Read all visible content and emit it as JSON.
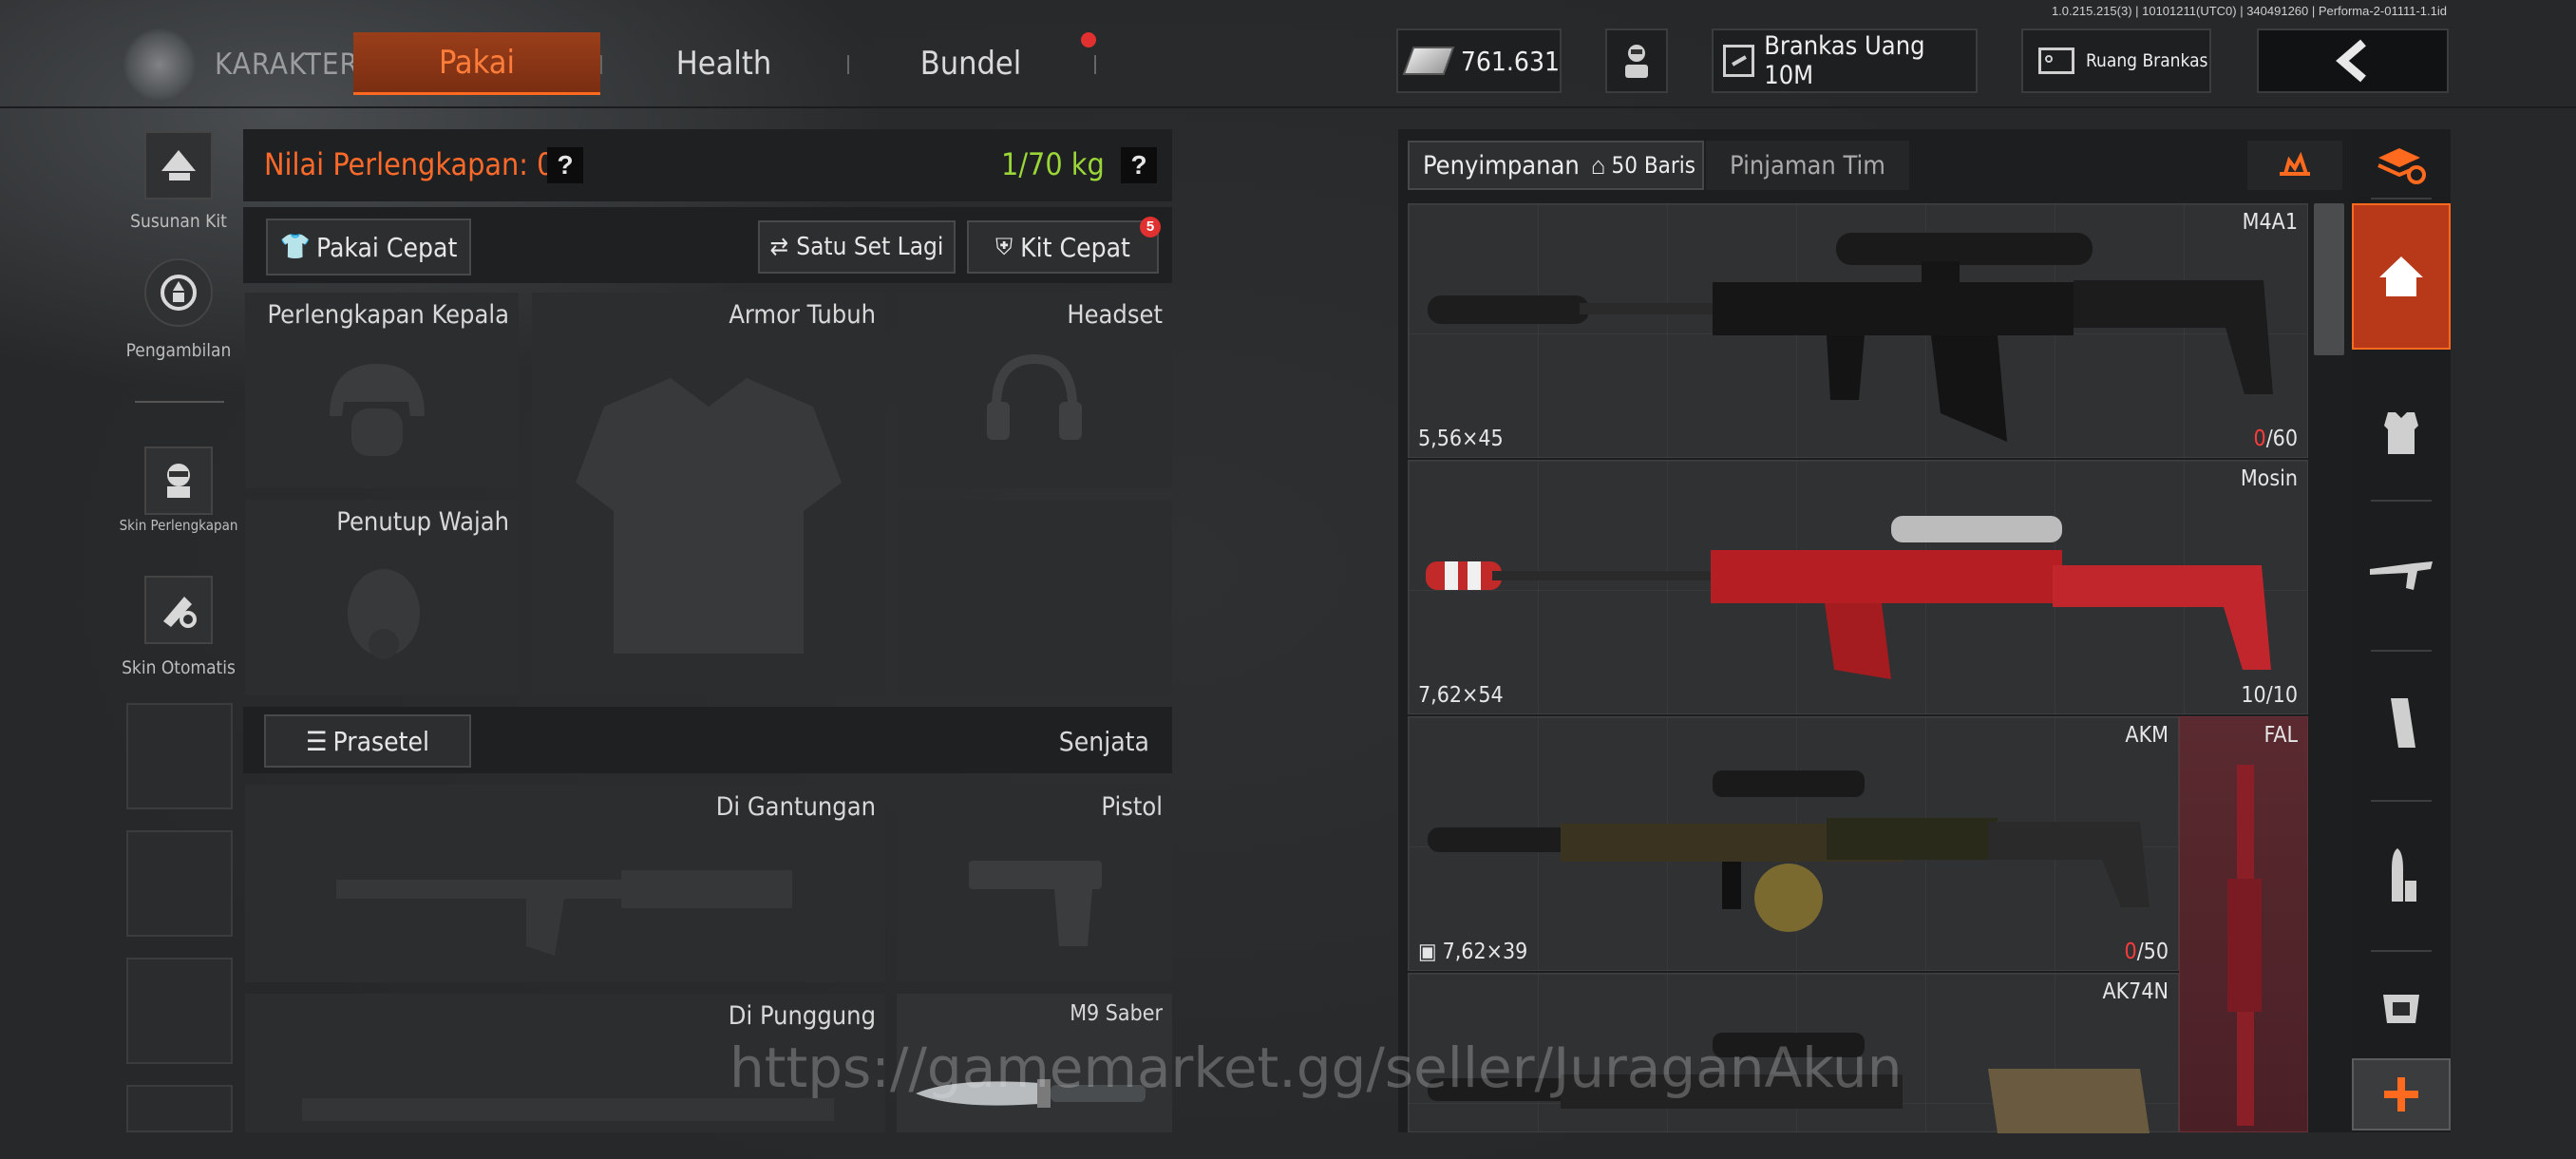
{
  "header": {
    "brand": "KARAKTER",
    "tabs": [
      {
        "label": "Pakai",
        "active": true
      },
      {
        "label": "Health",
        "active": false
      },
      {
        "label": "Bundel",
        "active": false
      }
    ],
    "currency": "761.631",
    "vault_money": "Brankas Uang 10M",
    "vault_room": "Ruang Brankas",
    "version_info": "1.0.215.215(3) | 10101211(UTC0) | 340491260 | Performa-2-01111-1.1id"
  },
  "sidebar": [
    {
      "label": "Susunan Kit",
      "icon": "kit-icon"
    },
    {
      "label": "Pengambilan",
      "icon": "retrieve-icon"
    },
    {
      "label": "Skin Perlengkapan",
      "icon": "gear-skin-icon"
    },
    {
      "label": "Skin Otomatis",
      "icon": "auto-skin-icon"
    }
  ],
  "equipment": {
    "value_label": "Nilai Perlengkapan: 0",
    "weight": "1/70 kg",
    "help": "?",
    "quick_wear": "Pakai Cepat",
    "one_more_set": "Satu Set Lagi",
    "quick_kit": "Kit Cepat",
    "quick_kit_badge": "5",
    "slots": {
      "head": "Perlengkapan Kepala",
      "body": "Armor Tubuh",
      "headset": "Headset",
      "face": "Penutup Wajah"
    },
    "preset": "Prasetel",
    "weapons_title": "Senjata",
    "weapon_slots": {
      "sling": "Di Gantungan",
      "pistol": "Pistol",
      "back": "Di Punggung",
      "melee": "M9 Saber"
    }
  },
  "storage": {
    "tab_storage": "Penyimpanan",
    "rows": "50 Baris",
    "tab_team_loan": "Pinjaman Tim",
    "weapons": [
      {
        "name": "M4A1",
        "caliber": "5,56×45",
        "count_current": "0",
        "count_total": "/60"
      },
      {
        "name": "Mosin",
        "caliber": "7,62×54",
        "count_current": "10",
        "count_total": "/10"
      },
      {
        "name": "AKM",
        "caliber": "7,62×39",
        "count_current": "0",
        "count_total": "/50",
        "side_name": "FAL"
      },
      {
        "name": "AK74N",
        "caliber": "",
        "count_current": "",
        "count_total": ""
      }
    ]
  },
  "watermark": "https://gamemarket.gg/seller/JuraganAkun",
  "colors": {
    "accent": "#ff6a1e",
    "weight_green": "#9bd639",
    "value_orange": "#ff6a2a",
    "badge_red": "#e03030"
  }
}
